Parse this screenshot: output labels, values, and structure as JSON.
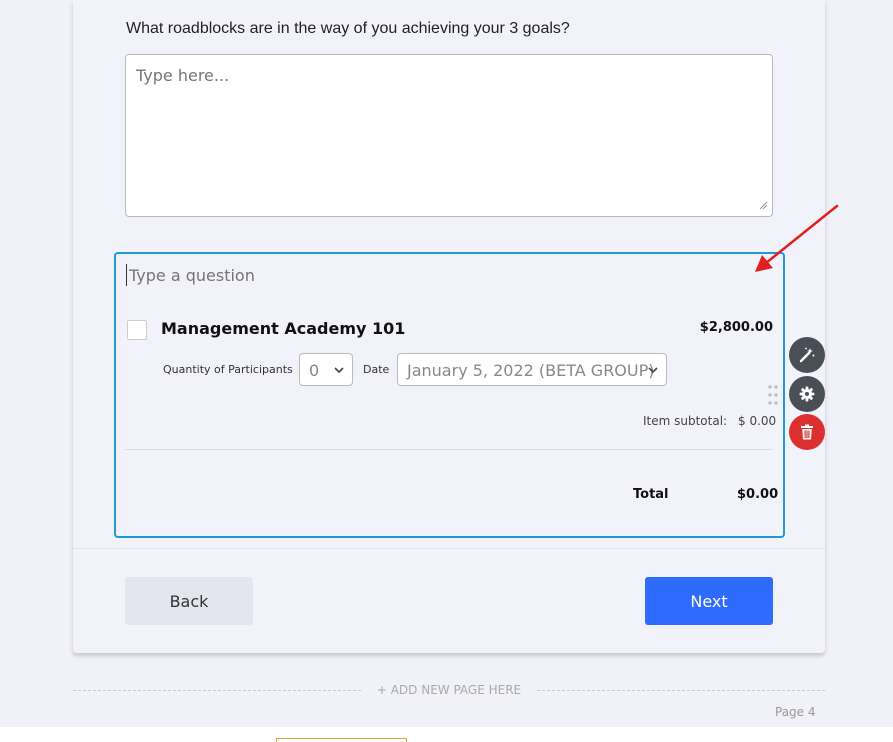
{
  "question1": {
    "label": "What roadblocks are in the way of you achieving your 3 goals?",
    "placeholder": "Type here..."
  },
  "block": {
    "question_placeholder": "Type a question",
    "product": {
      "name": "Management Academy 101",
      "price": "$2,800.00",
      "quantity_label": "Quantity of Participants",
      "quantity_value": "0",
      "date_label": "Date",
      "date_value": "January 5, 2022 (BETA GROUP)"
    },
    "subtotal_label": "Item subtotal:",
    "subtotal_value": "$ 0.00",
    "total_label": "Total",
    "total_value": "$0.00"
  },
  "tools": [
    {
      "icon": "magic-wand-icon",
      "color": "#4a4f57"
    },
    {
      "icon": "gear-icon",
      "color": "#4a4f57"
    },
    {
      "icon": "trash-icon",
      "color": "#dc3030"
    }
  ],
  "nav": {
    "back_label": "Back",
    "next_label": "Next"
  },
  "add_page_label": "+ ADD NEW PAGE HERE",
  "page_label": "Page 4",
  "colors": {
    "accent": "#2f6bff",
    "block_border": "#1e9ad6",
    "arrow": "#e02020",
    "delete": "#dc3030"
  }
}
